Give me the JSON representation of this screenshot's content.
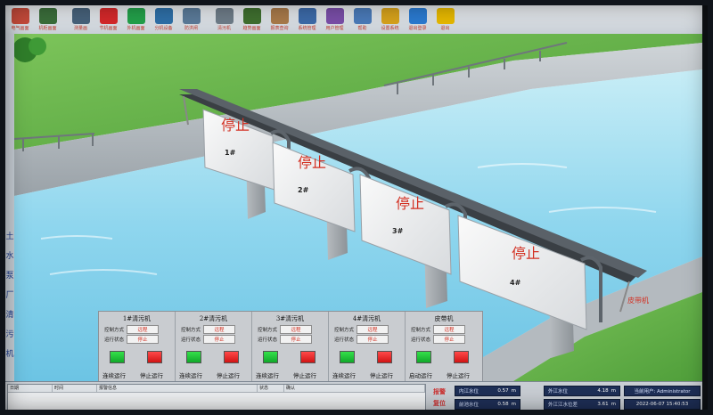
{
  "toolbar": {
    "buttons": [
      {
        "label": "电气画面",
        "icon": "electrical-icon",
        "color": "#c44a3a"
      },
      {
        "label": "机柜画面",
        "icon": "cabinet-icon",
        "color": "#3a6d3a"
      },
      {
        "label": "测量画",
        "icon": "measure-icon",
        "color": "#46617a"
      },
      {
        "label": "节机画面",
        "icon": "cycle-red-icon",
        "color": "#d4282a"
      },
      {
        "label": "外机画面",
        "icon": "cycle-green-icon",
        "color": "#23a04a"
      },
      {
        "label": "分机设备",
        "icon": "equipment-icon",
        "color": "#2e6fa7"
      },
      {
        "label": "防洪闸",
        "icon": "floodgate-icon",
        "color": "#5a7a98"
      },
      {
        "label": "清污机",
        "icon": "trash-rack-icon",
        "color": "#6e7c88"
      },
      {
        "label": "趋势画面",
        "icon": "trend-chart-icon",
        "color": "#3f6f2f"
      },
      {
        "label": "报表查询",
        "icon": "report-icon",
        "color": "#a87a4a"
      },
      {
        "label": "系统管理",
        "icon": "users-icon",
        "color": "#3c6aa8"
      },
      {
        "label": "用户管理",
        "icon": "user-admin-icon",
        "color": "#7a4ea8"
      },
      {
        "label": "帮助",
        "icon": "help-icon",
        "color": "#4a7ab8"
      },
      {
        "label": "设置系统",
        "icon": "settings-gear-icon",
        "color": "#d6a21c"
      },
      {
        "label": "退出登录",
        "icon": "logout-icon",
        "color": "#2a7ad0"
      },
      {
        "label": "退出",
        "icon": "exit-runner-icon",
        "color": "#e6b800"
      }
    ]
  },
  "left_panel": {
    "chars": [
      "土",
      "水",
      "泵",
      "厂",
      "清",
      "污",
      "机"
    ]
  },
  "scene": {
    "gates": [
      {
        "status": "停止",
        "number": "1#"
      },
      {
        "status": "停止",
        "number": "2#"
      },
      {
        "status": "停止",
        "number": "3#"
      },
      {
        "status": "停止",
        "number": "4#"
      }
    ],
    "conveyor_label": "皮带机",
    "colors": {
      "status_text": "#d33022",
      "water": "#8fd6ee",
      "grass": "#5fb548"
    }
  },
  "control_panel": {
    "row_labels": {
      "mode": "控制方式",
      "state": "运行状态"
    },
    "units": [
      {
        "title": "1#清污机",
        "mode": "远程",
        "state": "停止",
        "start_label": "连续运行",
        "stop_label": "停止运行"
      },
      {
        "title": "2#清污机",
        "mode": "远程",
        "state": "停止",
        "start_label": "连续运行",
        "stop_label": "停止运行"
      },
      {
        "title": "3#清污机",
        "mode": "远程",
        "state": "停止",
        "start_label": "连续运行",
        "stop_label": "停止运行"
      },
      {
        "title": "4#清污机",
        "mode": "远程",
        "state": "停止",
        "start_label": "连续运行",
        "stop_label": "停止运行"
      },
      {
        "title": "皮带机",
        "mode": "远程",
        "state": "停止",
        "start_label": "启动运行",
        "stop_label": "停止运行"
      }
    ]
  },
  "status_bar": {
    "alarm_columns": [
      "日期",
      "时间",
      "报警信息",
      "状态",
      "确认"
    ],
    "alarm_buttons": [
      "报警",
      "复位"
    ],
    "inner_level": {
      "label": "内江水位",
      "value": "0.57",
      "unit": "m"
    },
    "outer_level": {
      "label": "外江水位",
      "value": "4.18",
      "unit": "m"
    },
    "intake_level": {
      "label": "前池水位",
      "value": "0.58",
      "unit": "m"
    },
    "outer_flood": {
      "label": "外江江水位差",
      "value": "3.61",
      "unit": "m"
    },
    "user": "当前用户: Administrator",
    "datetime": "2022-06-07   15:40:53"
  }
}
